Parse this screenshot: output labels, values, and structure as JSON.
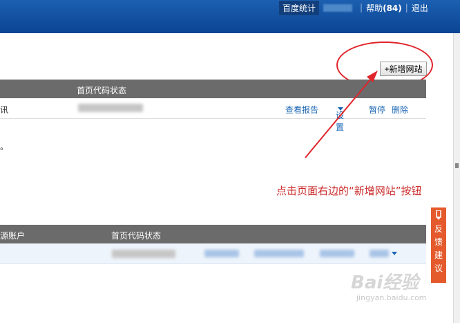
{
  "header": {
    "tab_active": "百度统计",
    "help": "帮助",
    "help_count": "(84)",
    "logout": "退出",
    "separator": "|"
  },
  "toolbar": {
    "add_site": "+新增网站"
  },
  "table1": {
    "col_status": "首页代码状态",
    "row": {
      "name_fragment": "讯",
      "view_report": "查看报告",
      "settings": "设置",
      "pause": "暂停",
      "delete": "删除"
    }
  },
  "misc": {
    "period": "。"
  },
  "annotation": {
    "text": "点击页面右边的“新增网站”按钮"
  },
  "table2": {
    "col_account": "源账户",
    "col_status": "首页代码状态"
  },
  "feedback": {
    "chars": [
      "反",
      "馈",
      "建",
      "议"
    ]
  },
  "watermark": {
    "logo": "Bai经验",
    "url": "jingyan.baidu.com"
  },
  "colors": {
    "topbar": "#0b4494",
    "accent_red": "#e0242b",
    "link": "#1b66b3",
    "feedback_bg": "#e45a2c"
  }
}
